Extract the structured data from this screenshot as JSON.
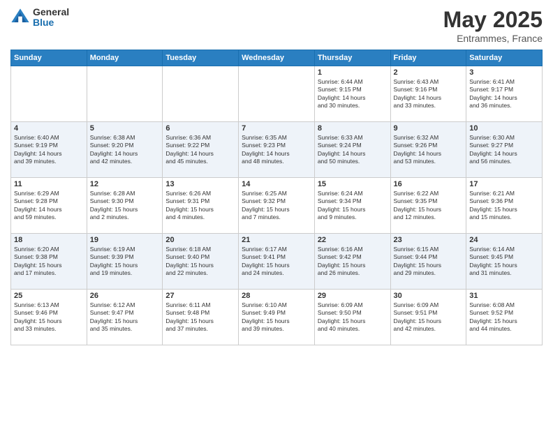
{
  "logo": {
    "general": "General",
    "blue": "Blue"
  },
  "header": {
    "title": "May 2025",
    "subtitle": "Entrammes, France"
  },
  "days_of_week": [
    "Sunday",
    "Monday",
    "Tuesday",
    "Wednesday",
    "Thursday",
    "Friday",
    "Saturday"
  ],
  "weeks": [
    [
      {
        "num": "",
        "info": ""
      },
      {
        "num": "",
        "info": ""
      },
      {
        "num": "",
        "info": ""
      },
      {
        "num": "",
        "info": ""
      },
      {
        "num": "1",
        "info": "Sunrise: 6:44 AM\nSunset: 9:15 PM\nDaylight: 14 hours\nand 30 minutes."
      },
      {
        "num": "2",
        "info": "Sunrise: 6:43 AM\nSunset: 9:16 PM\nDaylight: 14 hours\nand 33 minutes."
      },
      {
        "num": "3",
        "info": "Sunrise: 6:41 AM\nSunset: 9:17 PM\nDaylight: 14 hours\nand 36 minutes."
      }
    ],
    [
      {
        "num": "4",
        "info": "Sunrise: 6:40 AM\nSunset: 9:19 PM\nDaylight: 14 hours\nand 39 minutes."
      },
      {
        "num": "5",
        "info": "Sunrise: 6:38 AM\nSunset: 9:20 PM\nDaylight: 14 hours\nand 42 minutes."
      },
      {
        "num": "6",
        "info": "Sunrise: 6:36 AM\nSunset: 9:22 PM\nDaylight: 14 hours\nand 45 minutes."
      },
      {
        "num": "7",
        "info": "Sunrise: 6:35 AM\nSunset: 9:23 PM\nDaylight: 14 hours\nand 48 minutes."
      },
      {
        "num": "8",
        "info": "Sunrise: 6:33 AM\nSunset: 9:24 PM\nDaylight: 14 hours\nand 50 minutes."
      },
      {
        "num": "9",
        "info": "Sunrise: 6:32 AM\nSunset: 9:26 PM\nDaylight: 14 hours\nand 53 minutes."
      },
      {
        "num": "10",
        "info": "Sunrise: 6:30 AM\nSunset: 9:27 PM\nDaylight: 14 hours\nand 56 minutes."
      }
    ],
    [
      {
        "num": "11",
        "info": "Sunrise: 6:29 AM\nSunset: 9:28 PM\nDaylight: 14 hours\nand 59 minutes."
      },
      {
        "num": "12",
        "info": "Sunrise: 6:28 AM\nSunset: 9:30 PM\nDaylight: 15 hours\nand 2 minutes."
      },
      {
        "num": "13",
        "info": "Sunrise: 6:26 AM\nSunset: 9:31 PM\nDaylight: 15 hours\nand 4 minutes."
      },
      {
        "num": "14",
        "info": "Sunrise: 6:25 AM\nSunset: 9:32 PM\nDaylight: 15 hours\nand 7 minutes."
      },
      {
        "num": "15",
        "info": "Sunrise: 6:24 AM\nSunset: 9:34 PM\nDaylight: 15 hours\nand 9 minutes."
      },
      {
        "num": "16",
        "info": "Sunrise: 6:22 AM\nSunset: 9:35 PM\nDaylight: 15 hours\nand 12 minutes."
      },
      {
        "num": "17",
        "info": "Sunrise: 6:21 AM\nSunset: 9:36 PM\nDaylight: 15 hours\nand 15 minutes."
      }
    ],
    [
      {
        "num": "18",
        "info": "Sunrise: 6:20 AM\nSunset: 9:38 PM\nDaylight: 15 hours\nand 17 minutes."
      },
      {
        "num": "19",
        "info": "Sunrise: 6:19 AM\nSunset: 9:39 PM\nDaylight: 15 hours\nand 19 minutes."
      },
      {
        "num": "20",
        "info": "Sunrise: 6:18 AM\nSunset: 9:40 PM\nDaylight: 15 hours\nand 22 minutes."
      },
      {
        "num": "21",
        "info": "Sunrise: 6:17 AM\nSunset: 9:41 PM\nDaylight: 15 hours\nand 24 minutes."
      },
      {
        "num": "22",
        "info": "Sunrise: 6:16 AM\nSunset: 9:42 PM\nDaylight: 15 hours\nand 26 minutes."
      },
      {
        "num": "23",
        "info": "Sunrise: 6:15 AM\nSunset: 9:44 PM\nDaylight: 15 hours\nand 29 minutes."
      },
      {
        "num": "24",
        "info": "Sunrise: 6:14 AM\nSunset: 9:45 PM\nDaylight: 15 hours\nand 31 minutes."
      }
    ],
    [
      {
        "num": "25",
        "info": "Sunrise: 6:13 AM\nSunset: 9:46 PM\nDaylight: 15 hours\nand 33 minutes."
      },
      {
        "num": "26",
        "info": "Sunrise: 6:12 AM\nSunset: 9:47 PM\nDaylight: 15 hours\nand 35 minutes."
      },
      {
        "num": "27",
        "info": "Sunrise: 6:11 AM\nSunset: 9:48 PM\nDaylight: 15 hours\nand 37 minutes."
      },
      {
        "num": "28",
        "info": "Sunrise: 6:10 AM\nSunset: 9:49 PM\nDaylight: 15 hours\nand 39 minutes."
      },
      {
        "num": "29",
        "info": "Sunrise: 6:09 AM\nSunset: 9:50 PM\nDaylight: 15 hours\nand 40 minutes."
      },
      {
        "num": "30",
        "info": "Sunrise: 6:09 AM\nSunset: 9:51 PM\nDaylight: 15 hours\nand 42 minutes."
      },
      {
        "num": "31",
        "info": "Sunrise: 6:08 AM\nSunset: 9:52 PM\nDaylight: 15 hours\nand 44 minutes."
      }
    ]
  ]
}
